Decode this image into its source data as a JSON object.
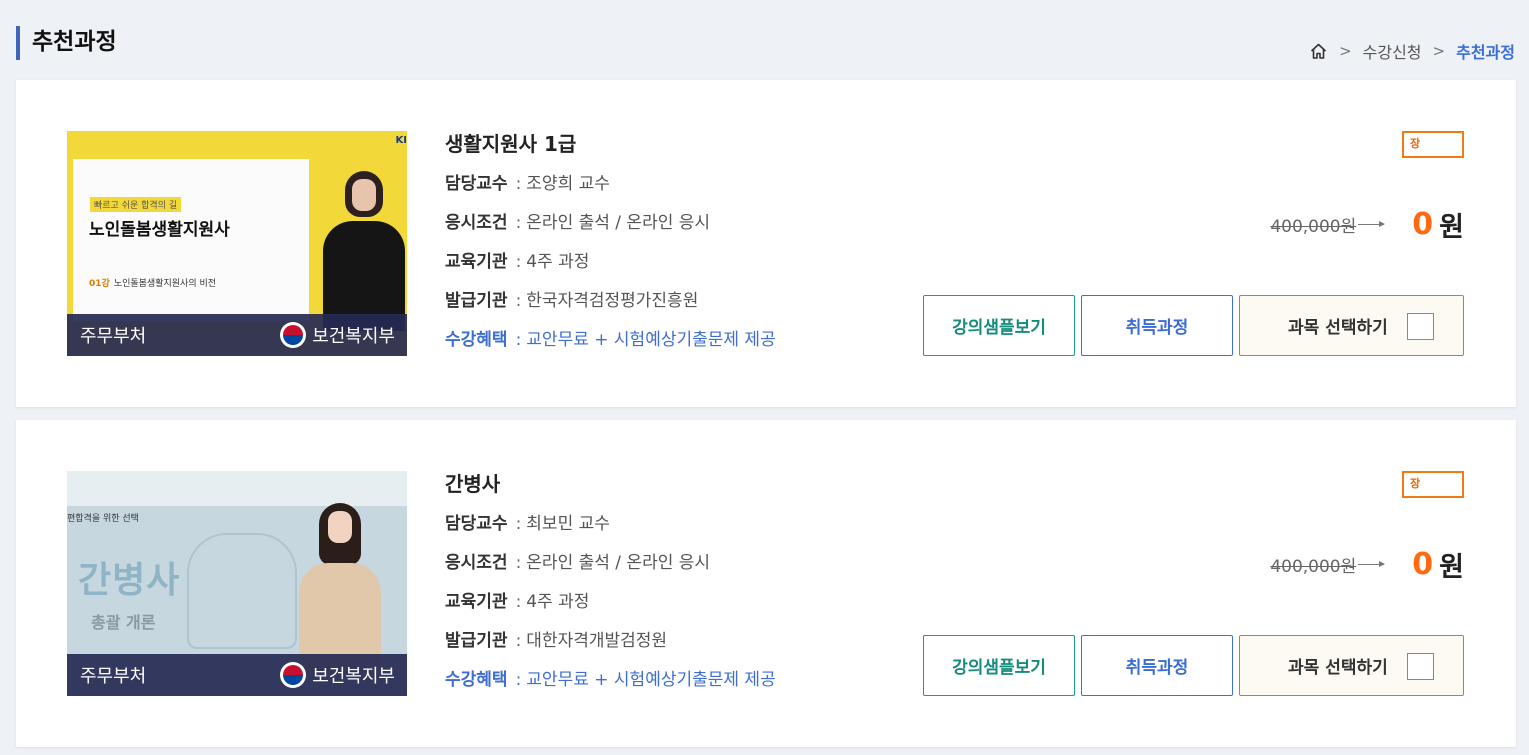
{
  "header": {
    "title": "추천과정",
    "breadcrumb": [
      "수강신청",
      "추천과정"
    ],
    "home_icon": "home-icon"
  },
  "labels": {
    "professor": "담당교수",
    "exam": "응시조건",
    "institution": "교육기관",
    "issuer": "발급기관",
    "benefit": "수강혜택",
    "currency": "원",
    "sample_button": "강의샘플보기",
    "course_button": "취득과정",
    "select_button": "과목 선택하기"
  },
  "courses": [
    {
      "title": "생활지원사 1급",
      "professor": "조양희 교수",
      "exam": "온라인 출석 / 온라인 응시",
      "institution": "4주 과정",
      "issuer": "한국자격검정평가진흥원",
      "benefit": "교안무료 + 시험예상기출문제 제공",
      "badge": "장",
      "old_price": "400,000원",
      "price": "0",
      "thumbnail": {
        "ministry_left": "주무부처",
        "ministry_right": "보건복지부",
        "small_text": "빠르고 쉬운 합격의 길",
        "big_text": "노인돌봄생활지원사",
        "lesson_no": "01강",
        "lesson_title": "노인돌봄생활지원사의 비전",
        "corner_logo": "KI",
        "bg_color": "#f3d83a"
      },
      "checked": false
    },
    {
      "title": "간병사",
      "professor": "최보민 교수",
      "exam": "온라인 출석 / 온라인 응시",
      "institution": "4주 과정",
      "issuer": "대한자격개발검정원",
      "benefit": "교안무료 + 시험예상기출문제 제공",
      "badge": "장",
      "old_price": "400,000원",
      "price": "0",
      "thumbnail": {
        "ministry_left": "주무부처",
        "ministry_right": "보건복지부",
        "small_text": "편합격을 위한 선택",
        "big_text": "간병사",
        "sub_text": "총괄 개론",
        "bg_color": "#c7d7df"
      },
      "checked": false
    }
  ],
  "colors": {
    "accent_blue": "#3a6fd8",
    "price_orange": "#ff6a10",
    "teal": "#158c7b"
  }
}
